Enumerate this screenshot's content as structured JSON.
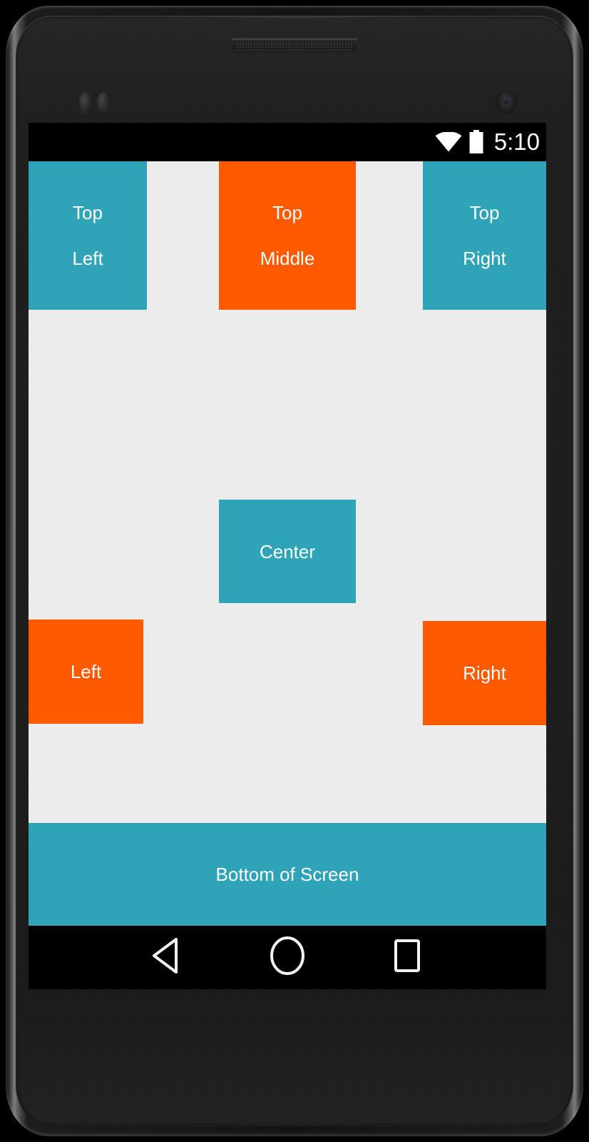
{
  "device": {
    "model_style": "android-phone-frame",
    "earpiece": "speaker-grille",
    "front_camera": "front-camera",
    "proximity_sensors": "proximity-sensors"
  },
  "status_bar": {
    "background_color": "#000000",
    "clock": "5:10",
    "icons": [
      {
        "name": "wifi-icon",
        "label": "wifi"
      },
      {
        "name": "battery-icon",
        "label": "battery"
      }
    ]
  },
  "colors": {
    "teal": "#2FA4B9",
    "orange": "#FF5A00",
    "screen_background": "#ECECEC",
    "text": "#FFFFFF",
    "system_bar": "#000000"
  },
  "layout": {
    "background_color": "#ECECEC",
    "boxes": [
      {
        "name": "top-left",
        "lines": [
          "Top",
          "Left"
        ],
        "color": "#2FA4B9"
      },
      {
        "name": "top-middle",
        "lines": [
          "Top",
          "Middle"
        ],
        "color": "#FF5A00"
      },
      {
        "name": "top-right",
        "lines": [
          "Top",
          "Right"
        ],
        "color": "#2FA4B9"
      },
      {
        "name": "center",
        "lines": [
          "Center"
        ],
        "color": "#2FA4B9"
      },
      {
        "name": "left",
        "lines": [
          "Left"
        ],
        "color": "#FF5A00"
      },
      {
        "name": "right",
        "lines": [
          "Right"
        ],
        "color": "#FF5A00"
      },
      {
        "name": "bottom",
        "lines": [
          "Bottom of Screen"
        ],
        "color": "#2FA4B9"
      }
    ]
  },
  "nav_bar": {
    "background_color": "#000000",
    "buttons": [
      {
        "name": "back-button",
        "icon": "back-triangle-icon"
      },
      {
        "name": "home-button",
        "icon": "home-circle-icon"
      },
      {
        "name": "recents-button",
        "icon": "recents-square-icon"
      }
    ]
  }
}
